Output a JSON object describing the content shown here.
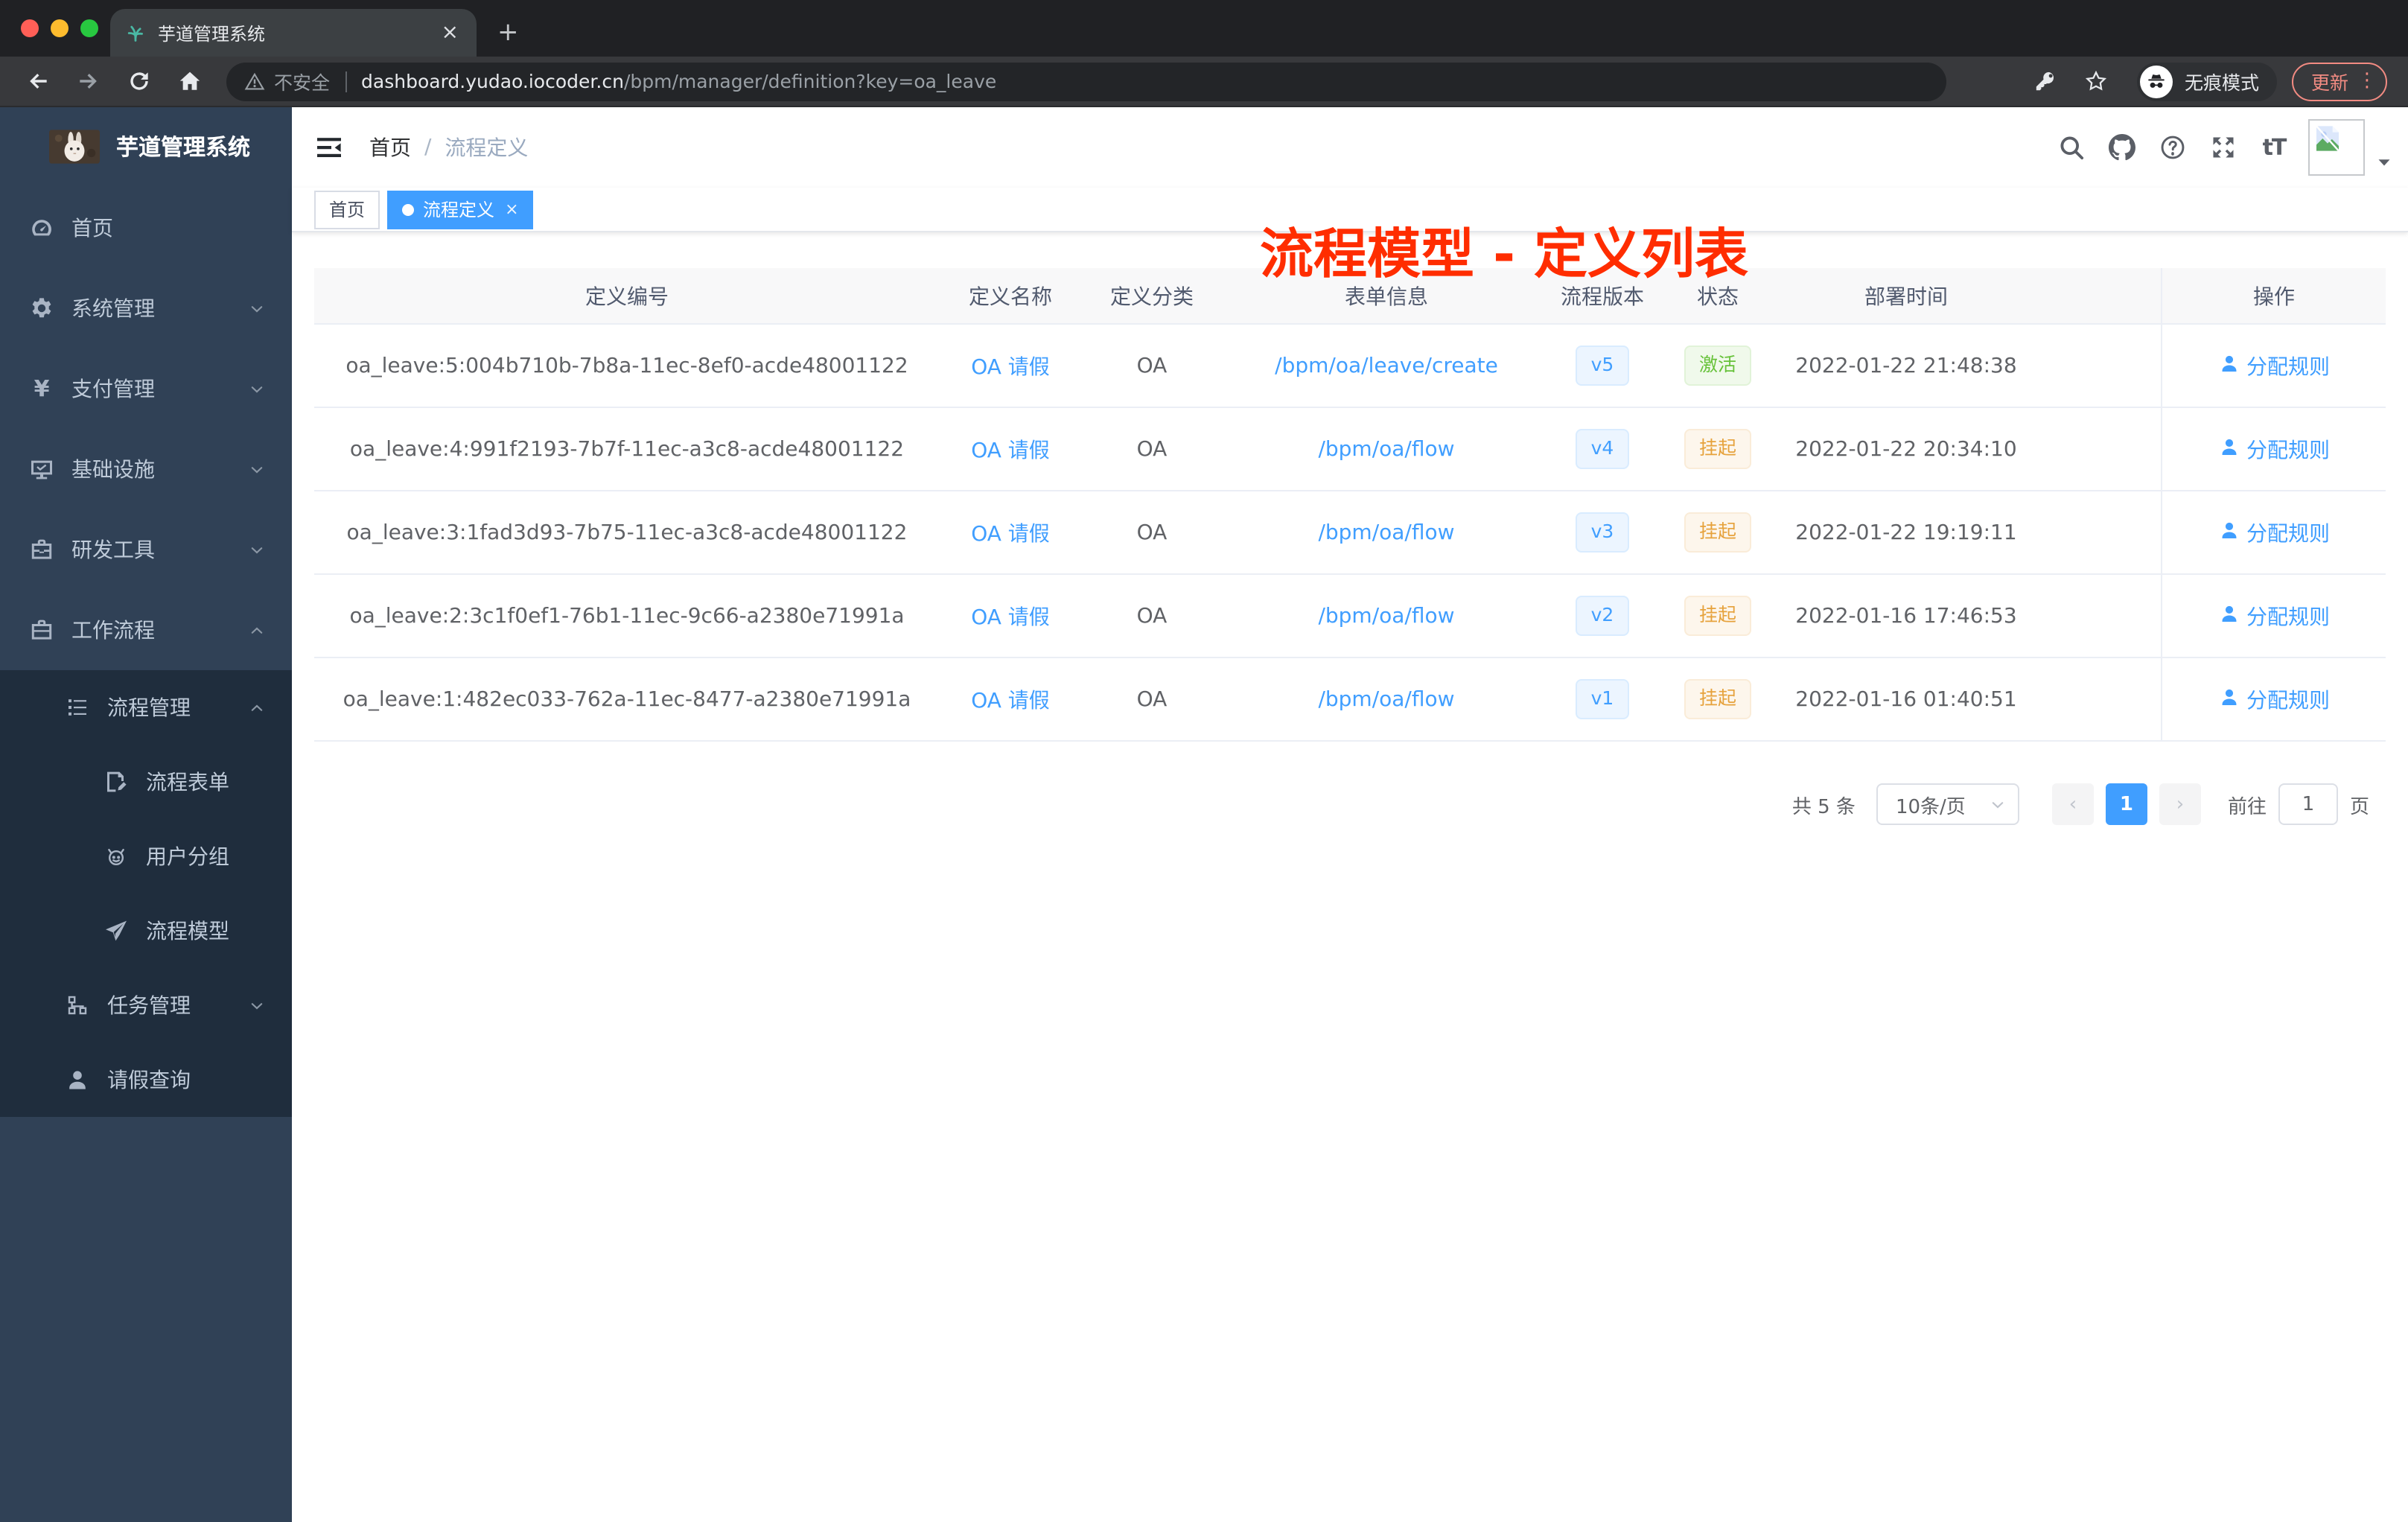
{
  "browser": {
    "tab_title": "芋道管理系统",
    "new_tab": "+",
    "close_glyph": "×",
    "not_secure": "不安全",
    "url_host": "dashboard.yudao.iocoder.cn",
    "url_path": "/bpm/manager/definition?key=oa_leave",
    "incognito_label": "无痕模式",
    "update_label": "更新",
    "menu_dots": "⋮"
  },
  "sidebar": {
    "app_title": "芋道管理系统",
    "menu": [
      {
        "key": "home",
        "label": "首页",
        "icon": "dashboard-icon",
        "level": 1,
        "arrow": null,
        "dark": false
      },
      {
        "key": "system",
        "label": "系统管理",
        "icon": "gear-icon",
        "level": 1,
        "arrow": "down",
        "dark": false
      },
      {
        "key": "pay",
        "label": "支付管理",
        "icon": "yen-icon",
        "level": 1,
        "arrow": "down",
        "dark": false
      },
      {
        "key": "infra",
        "label": "基础设施",
        "icon": "monitor-icon",
        "level": 1,
        "arrow": "down",
        "dark": false
      },
      {
        "key": "devtools",
        "label": "研发工具",
        "icon": "toolbox-icon",
        "level": 1,
        "arrow": "down",
        "dark": false
      },
      {
        "key": "workflow",
        "label": "工作流程",
        "icon": "briefcase-icon",
        "level": 1,
        "arrow": "up",
        "dark": false
      },
      {
        "key": "process-manage",
        "label": "流程管理",
        "icon": "list-icon",
        "level": 2,
        "arrow": "up",
        "dark": true
      },
      {
        "key": "process-form",
        "label": "流程表单",
        "icon": "form-icon",
        "level": 3,
        "arrow": null,
        "dark": true
      },
      {
        "key": "user-group",
        "label": "用户分组",
        "icon": "robot-icon",
        "level": 3,
        "arrow": null,
        "dark": true
      },
      {
        "key": "process-model",
        "label": "流程模型",
        "icon": "paper-plane-icon",
        "level": 3,
        "arrow": null,
        "dark": true
      },
      {
        "key": "task-manage",
        "label": "任务管理",
        "icon": "tree-icon",
        "level": 2,
        "arrow": "down",
        "dark": true
      },
      {
        "key": "leave-query",
        "label": "请假查询",
        "icon": "user-icon",
        "level": 2,
        "arrow": null,
        "dark": true
      }
    ]
  },
  "header": {
    "breadcrumb_home": "首页",
    "breadcrumb_sep": "/",
    "breadcrumb_current": "流程定义",
    "annotation": "流程模型 - 定义列表"
  },
  "tags": [
    {
      "label": "首页",
      "active": false
    },
    {
      "label": "流程定义",
      "active": true,
      "close": "×"
    }
  ],
  "table": {
    "columns": {
      "id": "定义编号",
      "name": "定义名称",
      "category": "定义分类",
      "form": "表单信息",
      "version": "流程版本",
      "status": "状态",
      "deploy_time": "部署时间",
      "actions": "操作"
    },
    "rows": [
      {
        "id": "oa_leave:5:004b710b-7b8a-11ec-8ef0-acde48001122",
        "name": "OA 请假",
        "category": "OA",
        "form": "/bpm/oa/leave/create",
        "version": "v5",
        "status": "激活",
        "status_type": "success",
        "deploy_time": "2022-01-22 21:48:38",
        "action": "分配规则"
      },
      {
        "id": "oa_leave:4:991f2193-7b7f-11ec-a3c8-acde48001122",
        "name": "OA 请假",
        "category": "OA",
        "form": "/bpm/oa/flow",
        "version": "v4",
        "status": "挂起",
        "status_type": "warning",
        "deploy_time": "2022-01-22 20:34:10",
        "action": "分配规则"
      },
      {
        "id": "oa_leave:3:1fad3d93-7b75-11ec-a3c8-acde48001122",
        "name": "OA 请假",
        "category": "OA",
        "form": "/bpm/oa/flow",
        "version": "v3",
        "status": "挂起",
        "status_type": "warning",
        "deploy_time": "2022-01-22 19:19:11",
        "action": "分配规则"
      },
      {
        "id": "oa_leave:2:3c1f0ef1-76b1-11ec-9c66-a2380e71991a",
        "name": "OA 请假",
        "category": "OA",
        "form": "/bpm/oa/flow",
        "version": "v2",
        "status": "挂起",
        "status_type": "warning",
        "deploy_time": "2022-01-16 17:46:53",
        "action": "分配规则"
      },
      {
        "id": "oa_leave:1:482ec033-762a-11ec-8477-a2380e71991a",
        "name": "OA 请假",
        "category": "OA",
        "form": "/bpm/oa/flow",
        "version": "v1",
        "status": "挂起",
        "status_type": "warning",
        "deploy_time": "2022-01-16 01:40:51",
        "action": "分配规则"
      }
    ]
  },
  "pagination": {
    "total": "共 5 条",
    "page_size": "10条/页",
    "prev": "‹",
    "current_page": "1",
    "next": "›",
    "goto_label": "前往",
    "goto_value": "1",
    "page_unit": "页"
  },
  "colors": {
    "accent_blue": "#409eff",
    "success_green": "#67c23a",
    "warning_orange": "#e6a23c",
    "annotation_red": "#ff2d00",
    "sidebar_bg": "#304156",
    "sidebar_submenu_bg": "#1f2d3d"
  }
}
